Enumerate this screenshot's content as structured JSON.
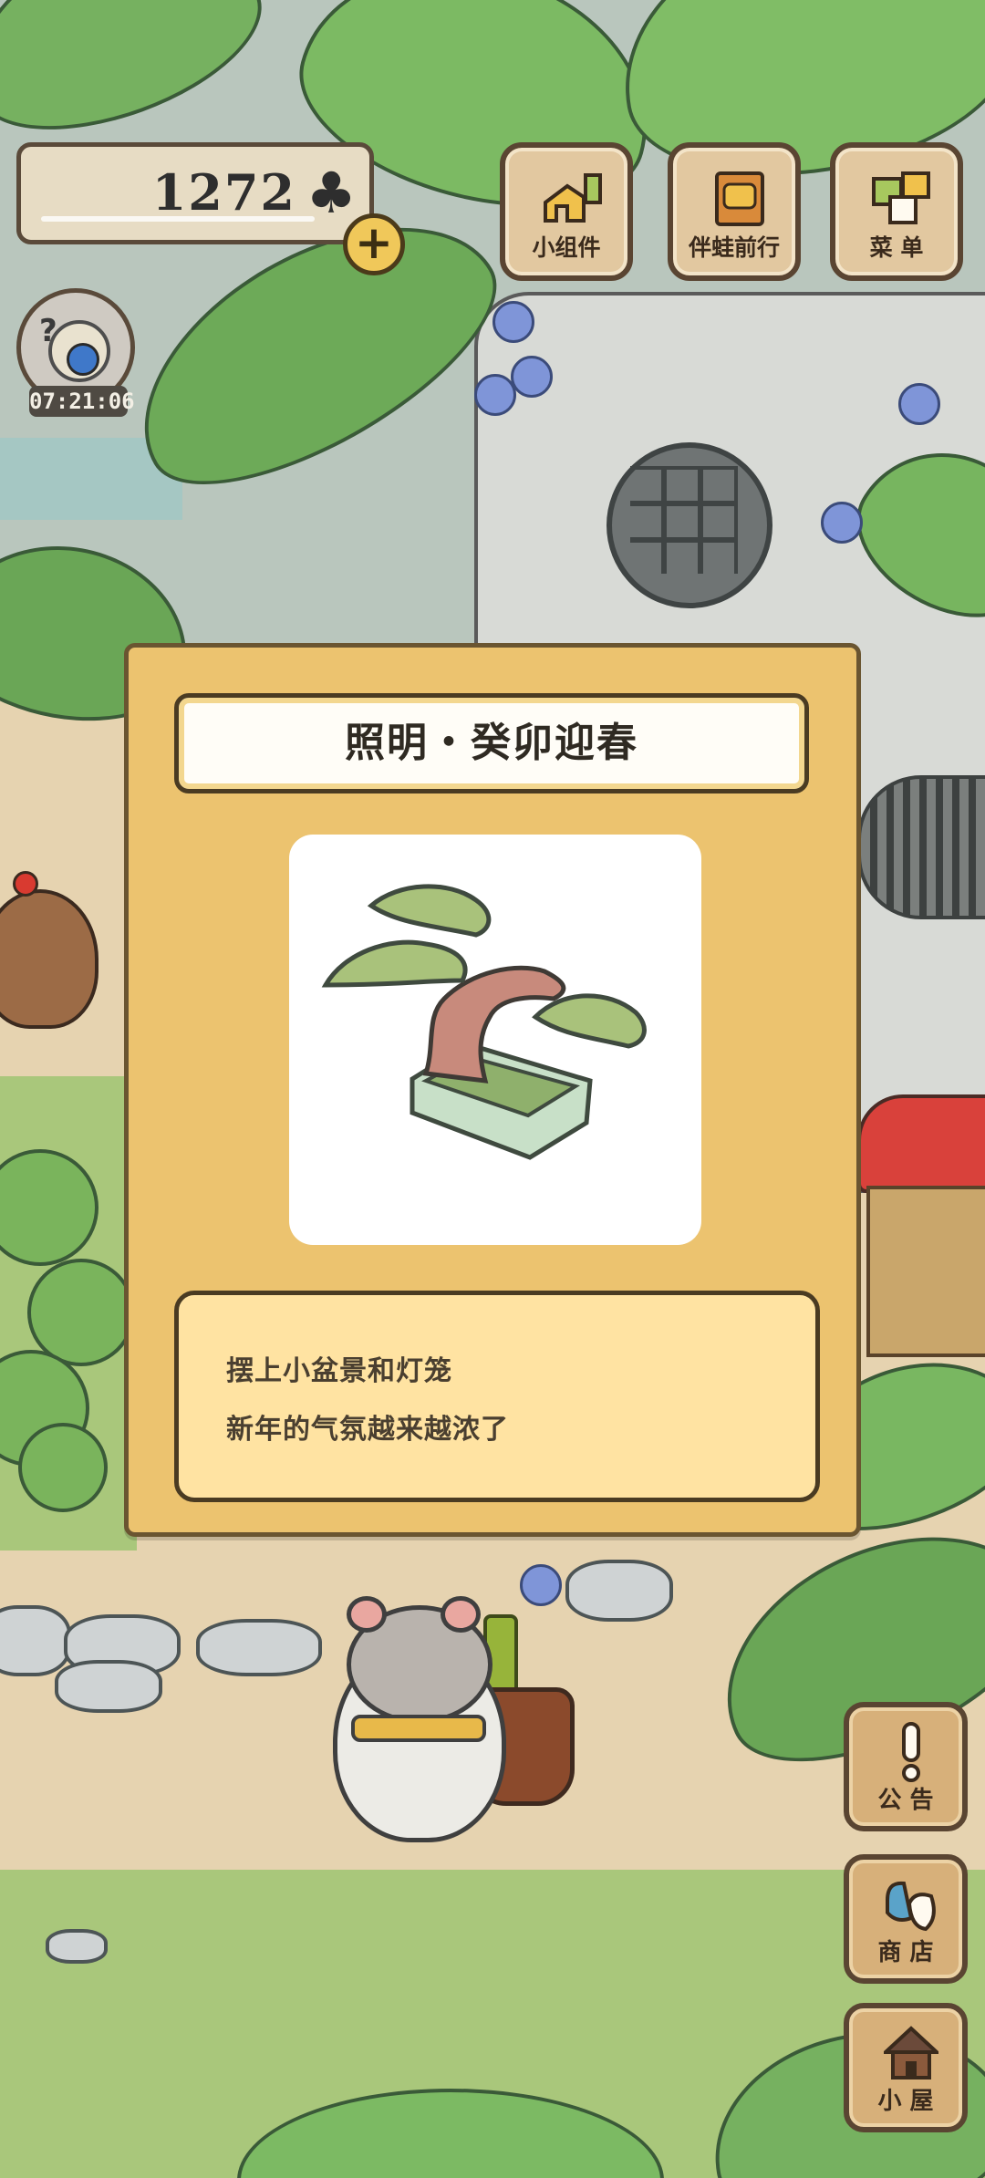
{
  "hud": {
    "clover_count": "1272",
    "clover_symbol": "♣",
    "add_symbol": "+",
    "visitor_timer": "07:21:06"
  },
  "top_buttons": {
    "widget_label": "小组件",
    "travel_label": "伴蛙前行",
    "menu_label": "菜 单"
  },
  "side_buttons": {
    "notice_label": "公 告",
    "shop_label": "商 店",
    "house_label": "小 屋"
  },
  "modal": {
    "title": "照明・癸卯迎春",
    "item_icon": "bonsai-in-tray-icon",
    "description": [
      "摆上小盆景和灯笼",
      "新年的气氛越来越浓了"
    ]
  },
  "colors": {
    "modal_bg": "#ecc36f",
    "desc_bg": "#ffe3a2",
    "button_bg": "#e2c8a0",
    "outline": "#4a3b22"
  }
}
